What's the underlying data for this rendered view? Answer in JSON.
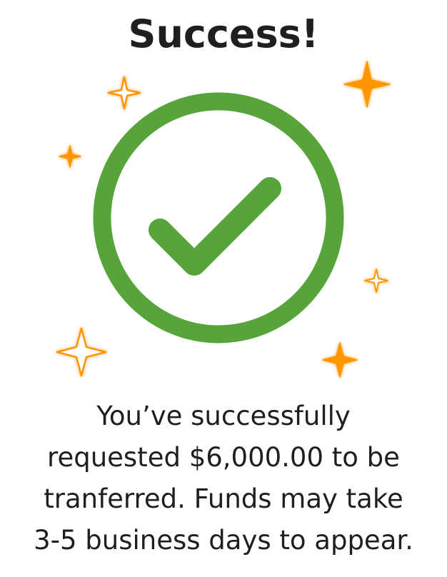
{
  "screen": {
    "title": "Success!",
    "message_lines": [
      "You’ve successfully",
      "requested $6,000.00 to be",
      "tranferred. Funds may take",
      "3-5 business days to appear."
    ]
  },
  "icons": {
    "status": "check-circle-icon",
    "decoration": "sparkle-icon"
  },
  "colors": {
    "success_green": "#56a43a",
    "sparkle_orange": "#ff9600",
    "text": "#1f1f1f",
    "background": "#ffffff"
  }
}
